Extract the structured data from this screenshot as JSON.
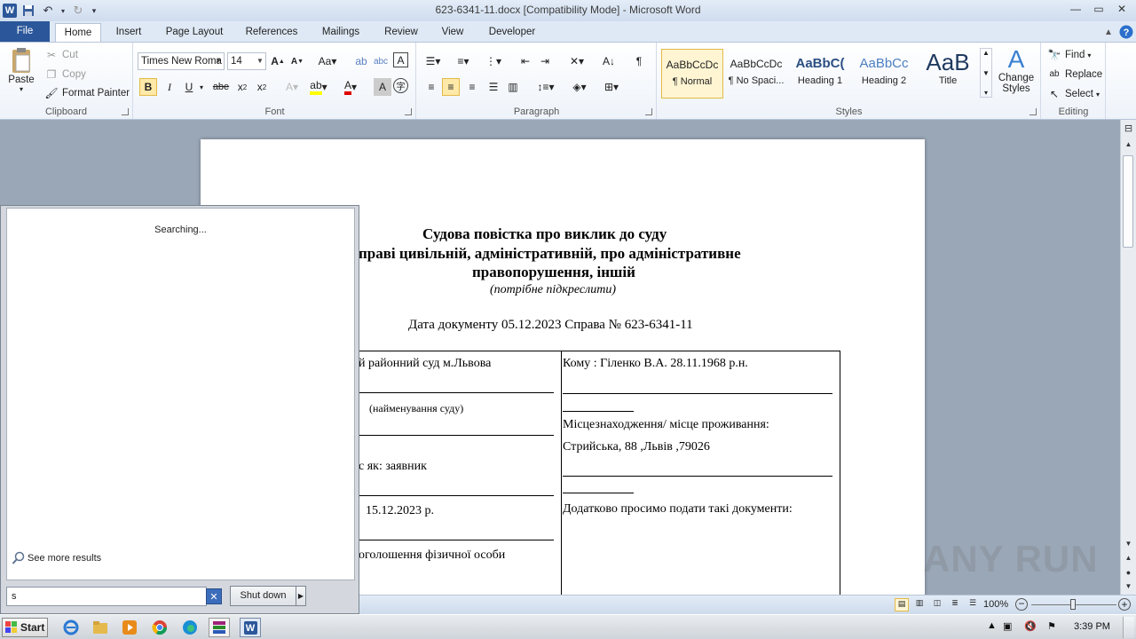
{
  "window": {
    "title": "623-6341-11.docx [Compatibility Mode]  -  Microsoft Word",
    "app_icon": "W"
  },
  "tabs": [
    "File",
    "Home",
    "Insert",
    "Page Layout",
    "References",
    "Mailings",
    "Review",
    "View",
    "Developer"
  ],
  "ribbon": {
    "clipboard": {
      "paste": "Paste",
      "cut": "Cut",
      "copy": "Copy",
      "format_painter": "Format Painter",
      "label": "Clipboard"
    },
    "font": {
      "family": "Times New Roma",
      "size": "14",
      "label": "Font"
    },
    "paragraph": {
      "label": "Paragraph"
    },
    "styles": {
      "items": [
        {
          "sample": "AaBbCcDc",
          "name": "¶ Normal"
        },
        {
          "sample": "AaBbCcDc",
          "name": "¶ No Spaci..."
        },
        {
          "sample": "AaBbC(",
          "name": "Heading 1"
        },
        {
          "sample": "AaBbCc",
          "name": "Heading 2"
        },
        {
          "sample": "AaB",
          "name": "Title"
        }
      ],
      "change_styles": "Change Styles",
      "label": "Styles"
    },
    "editing": {
      "find": "Find",
      "replace": "Replace",
      "select": "Select",
      "label": "Editing"
    }
  },
  "document": {
    "title_line1": "Судова повістка про виклик до суду",
    "title_line2": "праві цивільній, адміністративній, про адміністративне",
    "title_line3": "правопорушення, іншій",
    "subtitle": "(потрібне підкреслити)",
    "date_line": "Дата документу  05.12.2023 Справа № 623-6341-11",
    "left_col": {
      "court": "й районний суд м.Львова",
      "court_caption": "(найменування суду)",
      "role": "с як: заявник",
      "date": "15.12.2023 р.",
      "announce": "оголошення фізичної  особи"
    },
    "right_col": {
      "to": "Кому : Гіленко В.А.  28.11.1968 р.н.",
      "location_label": "Місцезнаходження/  місце проживання:",
      "address": "Стрийська, 88 ,Львів ,79026",
      "docs": "Додатково просимо подати такі документи:"
    }
  },
  "start_menu": {
    "status": "Searching...",
    "see_more": "See more results",
    "search_value": "s",
    "shutdown": "Shut down"
  },
  "statusbar": {
    "zoom": "100%"
  },
  "taskbar": {
    "start": "Start",
    "time": "3:39 PM"
  },
  "watermark": "ANY RUN"
}
